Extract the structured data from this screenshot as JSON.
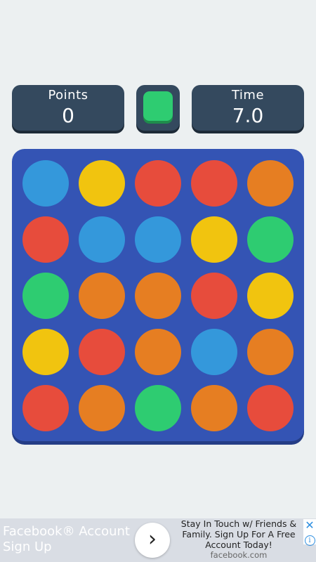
{
  "hud": {
    "points_label": "Points",
    "points_value": "0",
    "time_label": "Time",
    "time_value": "7.0",
    "target_color": "#2ecc71"
  },
  "colors": {
    "blue": "#3498db",
    "yellow": "#f1c40f",
    "red": "#e74c3c",
    "orange": "#e67e22",
    "green": "#2ecc71"
  },
  "grid": [
    [
      "blue",
      "yellow",
      "red",
      "red",
      "orange"
    ],
    [
      "red",
      "blue",
      "blue",
      "yellow",
      "green"
    ],
    [
      "green",
      "orange",
      "orange",
      "red",
      "yellow"
    ],
    [
      "yellow",
      "red",
      "orange",
      "blue",
      "orange"
    ],
    [
      "red",
      "orange",
      "green",
      "orange",
      "red"
    ]
  ],
  "ad": {
    "title": "Facebook® Account Sign Up",
    "description": "Stay In Touch w/ Friends & Family. Sign Up For A Free Account Today!",
    "domain": "facebook.com",
    "arrow_icon": "›",
    "close_icon": "✕",
    "info_icon": "i"
  }
}
